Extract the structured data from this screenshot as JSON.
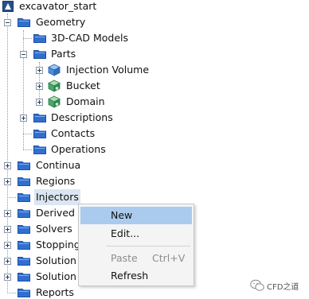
{
  "tree": {
    "root": "excavator_start",
    "geometry": "Geometry",
    "cad_models": "3D-CAD Models",
    "parts": "Parts",
    "injection_volume": "Injection Volume",
    "bucket": "Bucket",
    "domain": "Domain",
    "descriptions": "Descriptions",
    "contacts": "Contacts",
    "operations": "Operations",
    "continua": "Continua",
    "regions": "Regions",
    "injectors": "Injectors",
    "derived_parts": "Derived P",
    "solvers": "Solvers",
    "stopping_criteria": "Stopping",
    "solution_views": "Solution",
    "solution_histories": "Solution",
    "reports": "Reports"
  },
  "context_menu": {
    "new": "New",
    "edit": "Edit...",
    "paste": "Paste",
    "paste_shortcut": "Ctrl+V",
    "refresh": "Refresh"
  },
  "watermark": {
    "text": "CFD之道"
  },
  "colors": {
    "folder": "#2f6fd0",
    "menu_highlight": "#aacbed",
    "selected_row": "#dbe6f2",
    "cube_blue": "#4a8fdc",
    "cube_green": "#4aa86a"
  }
}
